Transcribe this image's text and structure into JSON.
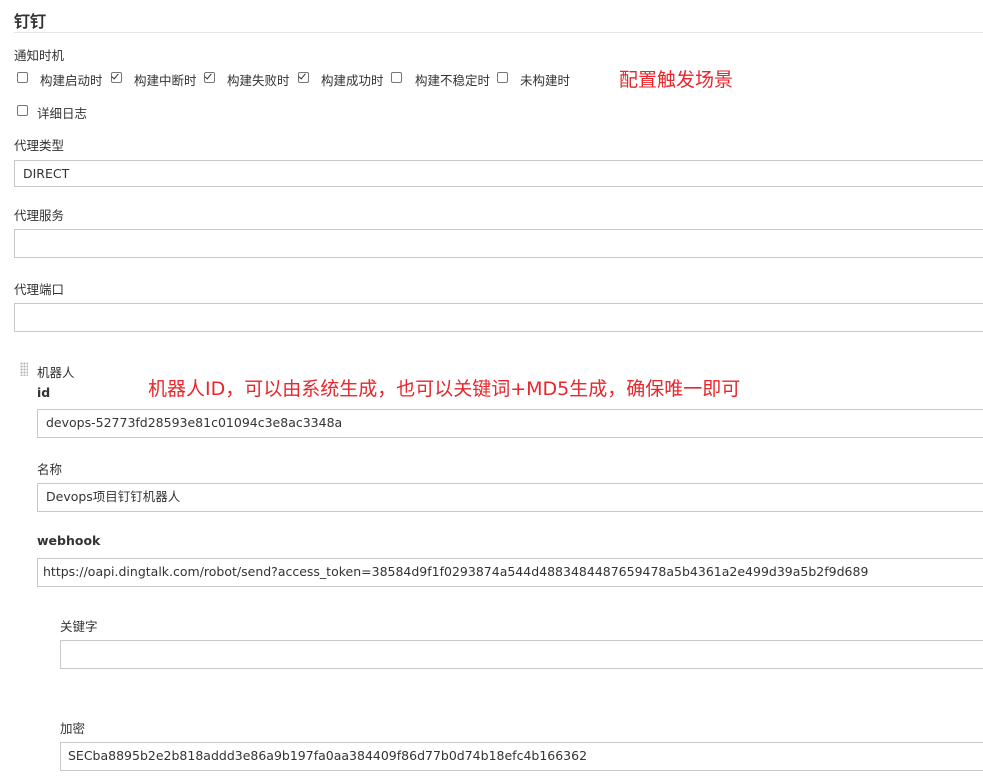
{
  "section": {
    "title": "钉钉"
  },
  "notify": {
    "label": "通知时机",
    "options": [
      {
        "label": "构建启动时",
        "checked": false
      },
      {
        "label": "构建中断时",
        "checked": true
      },
      {
        "label": "构建失败时",
        "checked": true
      },
      {
        "label": "构建成功时",
        "checked": true
      },
      {
        "label": "构建不稳定时",
        "checked": false
      },
      {
        "label": "未构建时",
        "checked": false
      }
    ],
    "verbose_label": "详细日志",
    "verbose_checked": false
  },
  "annotations": {
    "trigger": "配置触发场景",
    "robot_id": "机器人ID，可以由系统生成，也可以关键词+MD5生成，确保唯一即可"
  },
  "proxy": {
    "type_label": "代理类型",
    "type_value": "DIRECT",
    "server_label": "代理服务",
    "server_value": "",
    "port_label": "代理端口",
    "port_value": ""
  },
  "robot": {
    "header": "机器人",
    "id_label": "id",
    "id_value": "devops-52773fd28593e81c01094c3e8ac3348a",
    "name_label": "名称",
    "name_value": "Devops项目钉钉机器人",
    "webhook_label": "webhook",
    "webhook_value": "https://oapi.dingtalk.com/robot/send?access_token=38584d9f1f0293874a544d4883484487659478a5b4361a2e499d39a5b2f9d689",
    "keyword_label": "关键字",
    "keyword_value": "",
    "secret_label": "加密",
    "secret_value": "SECba8895b2e2b818addd3e86a9b197fa0aa384409f86d77b0d74b18efc4b166362"
  }
}
